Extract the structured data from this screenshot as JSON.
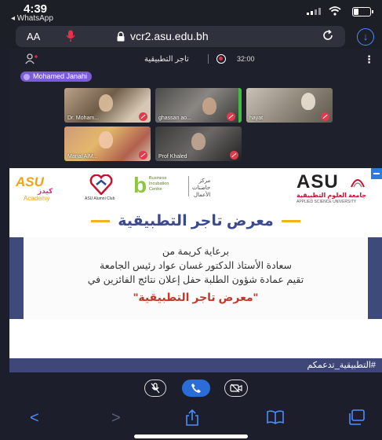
{
  "status_bar": {
    "time": "4:39",
    "back_app": "◂ WhatsApp"
  },
  "browser": {
    "aa_label": "AA",
    "domain": "vcr2.asu.edu.bh"
  },
  "meeting": {
    "room_name": "تاجر التطبيقية",
    "rec_time": "32:00",
    "active_speaker": "Mohamed Janahi",
    "participants": [
      {
        "label": "Dr. Moham..."
      },
      {
        "label": "ghassan ao..."
      },
      {
        "label": "hayat"
      },
      {
        "label": "Manal AlM..."
      },
      {
        "label": "Prof Khaled"
      }
    ]
  },
  "banner": {
    "logos": {
      "kids_text_1": "ASU",
      "kids_text_2": "كيدز",
      "kids_text_3": "Academy",
      "heart_caption": "ASU Alumni Club",
      "incubation_en": [
        "Business",
        "Incubation",
        "Centre"
      ],
      "incubation_ar": [
        "مركز",
        "حاضنات",
        "الأعمال"
      ],
      "asu": "ASU",
      "asu_ar": "جامعة العلوم التطبيقية",
      "asu_en": "APPLIED SCIENCE UNIVERSITY"
    },
    "title": "معرض تاجر التطبيقية",
    "line1": "برعاية كريمة من",
    "line2": "سعادة الأستاذ الدكتور غسان عواد رئيس الجامعة",
    "line3": "تقيم عمادة شؤون الطلبة حفل إعلان نتائج الفائزين في",
    "line4": "\"معرض تاجر التطبيقية\""
  },
  "hashtag": "#التطبيقية_تدعمكم",
  "colors": {
    "accent_blue": "#4c8dff",
    "record_red": "#e8304a",
    "speaker_purple": "#7a5bd8",
    "banner_navy": "#3d4a7a",
    "title_navy": "#3b4a8f",
    "highlight_yellow": "#f2b21b"
  },
  "icons": {
    "microphone": "microphone-icon",
    "lock": "lock-icon",
    "reload": "reload-icon",
    "download": "download-icon",
    "participants": "participants-icon",
    "record": "record-icon",
    "more": "more-icon",
    "mute_mic": "mute-mic-icon",
    "phone": "phone-icon",
    "camera_off": "camera-off-icon",
    "back": "back-icon",
    "forward": "forward-icon",
    "share": "share-icon",
    "bookmarks": "bookmarks-icon",
    "tabs": "tabs-icon"
  }
}
